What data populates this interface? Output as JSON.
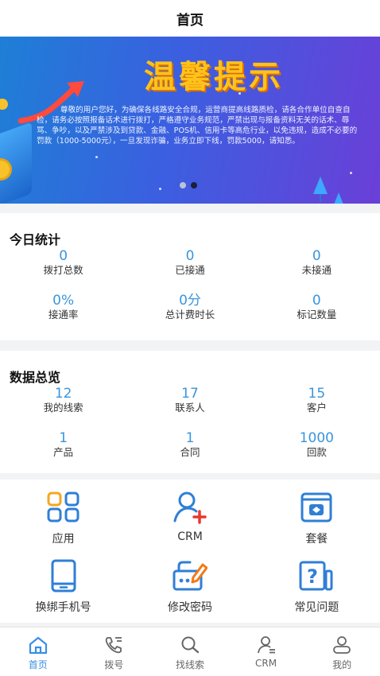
{
  "header": {
    "title": "首页"
  },
  "banner": {
    "title": "温馨提示",
    "body": "尊敬的用户您好，为确保各线路安全合规，运营商提高线路质检，请各合作单位自查自检，请务必按照报备话术进行拨打，严格遵守业务规范，严禁出现与报备资料无关的话术、辱骂、争吵，以及严禁涉及到贷款、金融、POS机、信用卡等高危行业，以免违规，造成不必要的罚款（1000-5000元），一旦发现诈骗，业务立即下线，罚款5000，请知悉。",
    "page_index": 2,
    "page_count": 2
  },
  "today": {
    "title": "今日统计",
    "items": [
      {
        "value": "0",
        "label": "拨打总数"
      },
      {
        "value": "0",
        "label": "已接通"
      },
      {
        "value": "0",
        "label": "未接通"
      },
      {
        "value": "0%",
        "label": "接通率"
      },
      {
        "value": "0分",
        "label": "总计费时长"
      },
      {
        "value": "0",
        "label": "标记数量"
      }
    ]
  },
  "overview": {
    "title": "数据总览",
    "items": [
      {
        "value": "12",
        "label": "我的线索"
      },
      {
        "value": "17",
        "label": "联系人"
      },
      {
        "value": "15",
        "label": "客户"
      },
      {
        "value": "1",
        "label": "产品"
      },
      {
        "value": "1",
        "label": "合同"
      },
      {
        "value": "1000",
        "label": "回款"
      }
    ]
  },
  "menu": {
    "items": [
      {
        "label": "应用",
        "icon": "apps-icon"
      },
      {
        "label": "CRM",
        "icon": "add-user-icon"
      },
      {
        "label": "套餐",
        "icon": "package-icon"
      },
      {
        "label": "换绑手机号",
        "icon": "phone-icon"
      },
      {
        "label": "修改密码",
        "icon": "edit-password-icon"
      },
      {
        "label": "常见问题",
        "icon": "question-icon"
      }
    ]
  },
  "tabbar": {
    "items": [
      {
        "label": "首页",
        "icon": "home-icon",
        "active": true
      },
      {
        "label": "拨号",
        "icon": "dial-icon",
        "active": false
      },
      {
        "label": "找线索",
        "icon": "search-icon",
        "active": false
      },
      {
        "label": "CRM",
        "icon": "crm-icon",
        "active": false
      },
      {
        "label": "我的",
        "icon": "profile-icon",
        "active": false
      }
    ]
  },
  "colors": {
    "accent": "#3a95dd",
    "active_tab": "#3a8ee6",
    "icon_blue": "#2f7fd6",
    "icon_red": "#e8382e",
    "banner_title": "#ffc21a"
  }
}
